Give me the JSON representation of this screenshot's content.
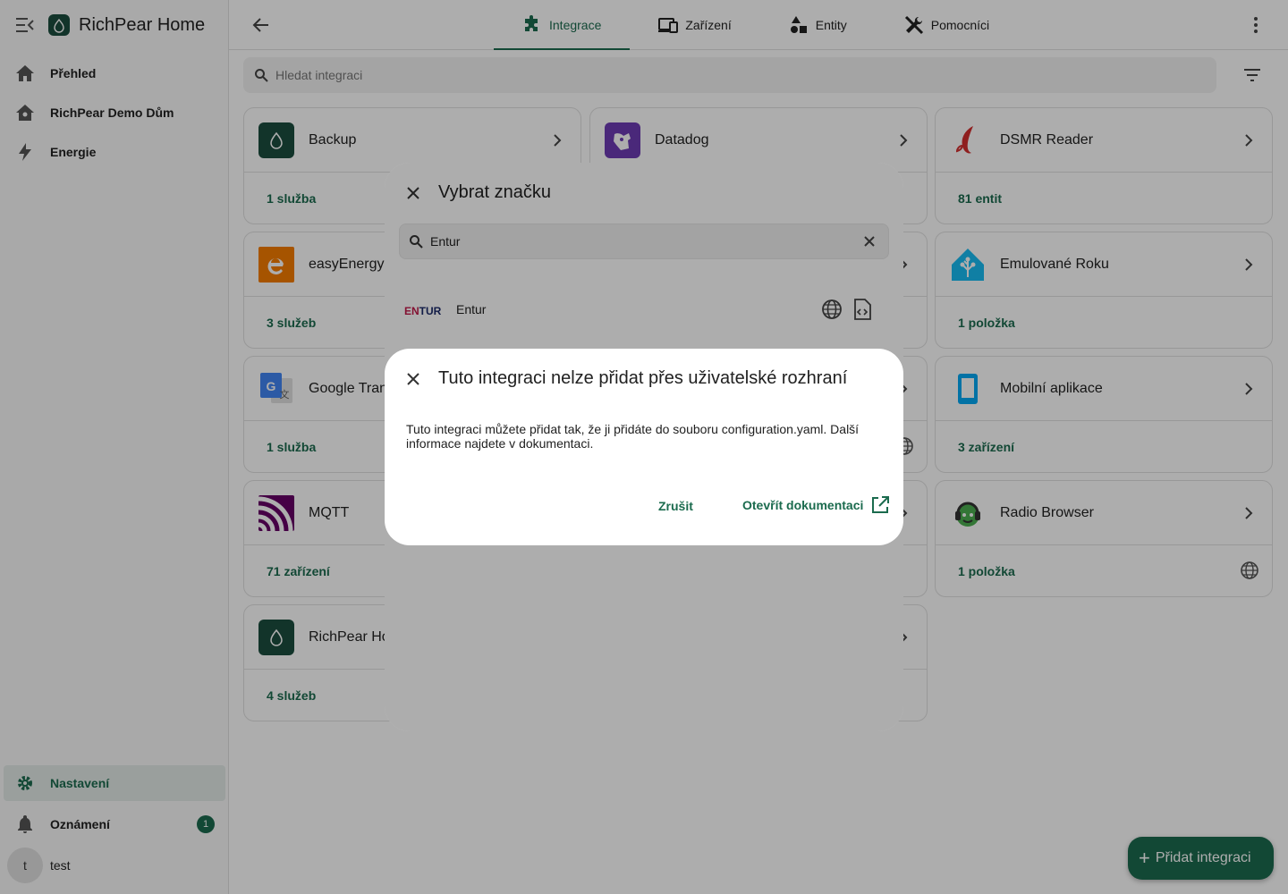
{
  "app": {
    "title": "RichPear Home"
  },
  "sidebar": {
    "items": [
      {
        "label": "Přehled",
        "icon": "home-icon"
      },
      {
        "label": "RichPear Demo Dům",
        "icon": "home-outline-icon"
      },
      {
        "label": "Energie",
        "icon": "lightning-icon"
      }
    ],
    "bottom": {
      "settings": "Nastavení",
      "notifications": "Oznámení",
      "notifications_count": "1",
      "user_initial": "t",
      "user_name": "test"
    }
  },
  "tabs": [
    {
      "label": "Integrace",
      "active": true
    },
    {
      "label": "Zařízení"
    },
    {
      "label": "Entity"
    },
    {
      "label": "Pomocníci"
    }
  ],
  "search": {
    "placeholder": "Hledat integraci"
  },
  "cards": [
    {
      "title": "Backup",
      "footer": "1 služba"
    },
    {
      "title": "Datadog",
      "footer": ""
    },
    {
      "title": "DSMR Reader",
      "footer": "81 entit"
    },
    {
      "title": "easyEnergy",
      "footer": "3 služeb"
    },
    {
      "title": "Emulované Roku",
      "footer": "1 položka"
    },
    {
      "title": "Google Tran",
      "footer": "1 služba"
    },
    {
      "title": "Mobilní aplikace",
      "footer": "3 zařízení"
    },
    {
      "title": "MQTT",
      "footer": "71 zařízení"
    },
    {
      "title": "Radio Browser",
      "footer": "1 položka"
    },
    {
      "title": "RichPear Ho",
      "footer": "4 služeb"
    }
  ],
  "fab": {
    "label": "Přidat integraci"
  },
  "brand_dialog": {
    "title": "Vybrat značku",
    "search_value": "Entur",
    "result": {
      "logo_en": "EN",
      "logo_tur": "TUR",
      "label": "Entur"
    }
  },
  "alert_dialog": {
    "title": "Tuto integraci nelze přidat přes uživatelské rozhraní",
    "body": "Tuto integraci můžete přidat tak, že ji přidáte do souboru configuration.yaml. Další informace najdete v dokumentaci.",
    "cancel": "Zrušit",
    "docs": "Otevřít dokumentaci"
  },
  "colors": {
    "primary": "#1b6b4e",
    "scrim": "rgba(0,0,0,0.32)"
  }
}
